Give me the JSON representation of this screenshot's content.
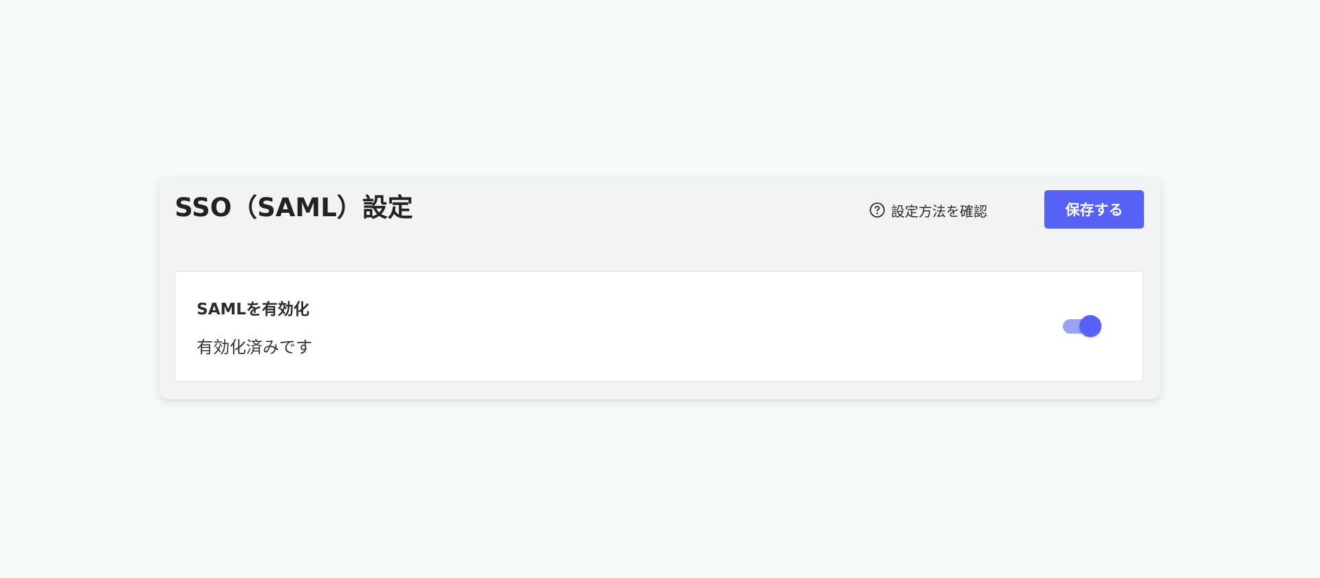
{
  "header": {
    "title": "SSO（SAML）設定",
    "help_link_label": "設定方法を確認",
    "help_icon": "question-circle-icon",
    "save_label": "保存する"
  },
  "saml_setting": {
    "label": "SAMLを有効化",
    "status": "有効化済みです",
    "enabled": true
  },
  "colors": {
    "accent": "#5662f6",
    "toggle_track": "#9aa1f8",
    "page_background": "#f5fbf9",
    "card_background": "#f2f3f5"
  }
}
